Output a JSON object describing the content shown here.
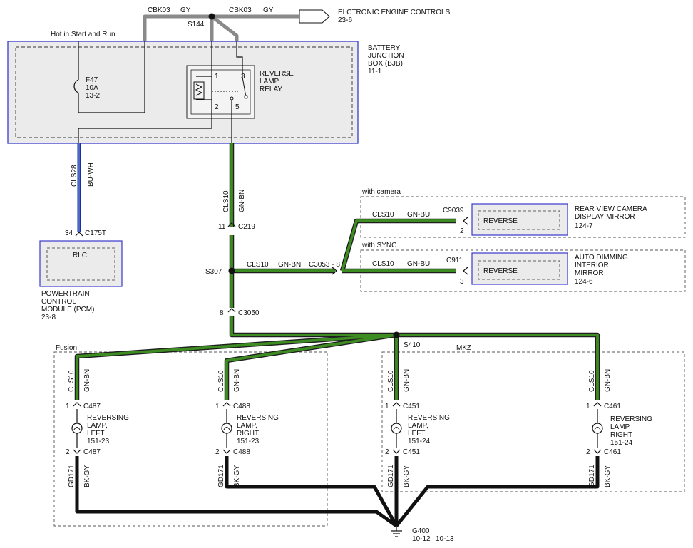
{
  "top": {
    "wire_left": "CBK03",
    "wire_left_color": "GY",
    "wire_right": "CBK03",
    "wire_right_color": "GY",
    "splice": "S144",
    "electronic_controls": "ELCTRONIC ENGINE CONTROLS",
    "electronic_controls_ref": "23-6",
    "hot_label": "Hot in Start and Run"
  },
  "bjb": {
    "title1": "BATTERY",
    "title2": "JUNCTION",
    "title3": "BOX (BJB)",
    "ref": "11-1",
    "fuse_id": "F47",
    "fuse_rating": "10A",
    "fuse_ref": "13-2",
    "relay_l1": "REVERSE",
    "relay_l2": "LAMP",
    "relay_l3": "RELAY",
    "pin1": "1",
    "pin2": "2",
    "pin3": "3",
    "pin5": "5"
  },
  "pcm": {
    "wire": "CLS28",
    "wire_color": "BU-WH",
    "pin": "34",
    "connector": "C175T",
    "box_label": "RLC",
    "name1": "POWERTRAIN",
    "name2": "CONTROL",
    "name3": "MODULE (PCM)",
    "ref": "23-8"
  },
  "main": {
    "wire": "CLS10",
    "wire_color": "GN-BN",
    "c219_pin": "11",
    "c219": "C219",
    "splice": "S307",
    "c3050_pin": "8",
    "c3050": "C3050",
    "branch_wire": "CLS10",
    "branch_color": "GN-BN",
    "c3053": "C3053 - 8"
  },
  "camera": {
    "option": "with camera",
    "wire": "CLS10",
    "wire_color": "GN-BU",
    "connector": "C9039",
    "pin": "2",
    "box_label": "REVERSE",
    "name1": "REAR VIEW CAMERA",
    "name2": "DISPLAY MIRROR",
    "ref": "124-7"
  },
  "sync": {
    "option": "with SYNC",
    "wire": "CLS10",
    "wire_color": "GN-BU",
    "connector": "C911",
    "pin": "3",
    "box_label": "REVERSE",
    "name1": "AUTO DIMMING",
    "name2": "INTERIOR",
    "name3": "MIRROR",
    "ref": "124-6"
  },
  "splice_s410": "S410",
  "fusion_label": "Fusion",
  "mkz_label": "MKZ",
  "lamps": [
    {
      "wire": "CLS10",
      "color": "GN-BN",
      "pin_top": "1",
      "conn": "C487",
      "n1": "REVERSING",
      "n2": "LAMP,",
      "n3": "LEFT",
      "ref": "151-23",
      "pin_bot": "2",
      "conn_bot": "C487",
      "gwire": "GD171",
      "gcolor": "BK-GY"
    },
    {
      "wire": "CLS10",
      "color": "GN-BN",
      "pin_top": "1",
      "conn": "C488",
      "n1": "REVERSING",
      "n2": "LAMP,",
      "n3": "RIGHT",
      "ref": "151-23",
      "pin_bot": "2",
      "conn_bot": "C488",
      "gwire": "GD171",
      "gcolor": "BK-GY"
    },
    {
      "wire": "CLS10",
      "color": "GN-BN",
      "pin_top": "1",
      "conn": "C451",
      "n1": "REVERSING",
      "n2": "LAMP,",
      "n3": "LEFT",
      "ref": "151-24",
      "pin_bot": "2",
      "conn_bot": "C451",
      "gwire": "GD171",
      "gcolor": "BK-GY"
    },
    {
      "wire": "CLS10",
      "color": "GN-BN",
      "pin_top": "1",
      "conn": "C461",
      "n1": "REVERSING",
      "n2": "LAMP,",
      "n3": "RIGHT",
      "ref": "151-24",
      "pin_bot": "2",
      "conn_bot": "C461",
      "gwire": "GD171",
      "gcolor": "BK-GY"
    }
  ],
  "ground": {
    "id": "G400",
    "ref1": "10-12",
    "ref2": "10-13"
  },
  "colors": {
    "gray_wire": "#8a8a8a",
    "green_wire": "#2f7a1f",
    "blue_wire": "#1c2f9e",
    "black_wire": "#111111",
    "box_fill": "#ebebeb",
    "box_border": "#3a3acc"
  }
}
